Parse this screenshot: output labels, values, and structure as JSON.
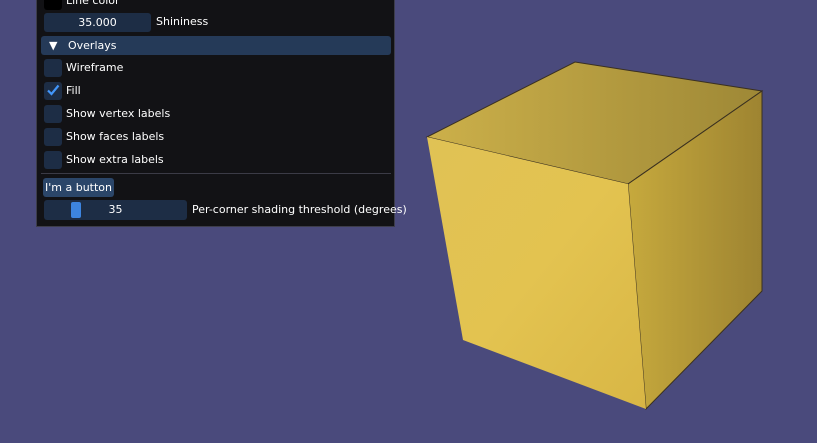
{
  "viewport": {
    "background_color": "#4a4a7c",
    "object": "cube",
    "cube_color": "#e0c14f"
  },
  "panel": {
    "line_color_label": "Line color",
    "line_color_swatch": "#000000",
    "shininess": {
      "value": "35.000",
      "label": "Shininess"
    },
    "overlays_header": {
      "arrow": "▼",
      "label": "Overlays"
    },
    "checkboxes": [
      {
        "label": "Wireframe",
        "checked": false
      },
      {
        "label": "Fill",
        "checked": true
      },
      {
        "label": "Show vertex labels",
        "checked": false
      },
      {
        "label": "Show faces labels",
        "checked": false
      },
      {
        "label": "Show extra labels",
        "checked": false
      }
    ],
    "button_label": "I'm a button",
    "threshold_slider": {
      "value": "35",
      "fraction": 0.194,
      "label": "Per-corner shading threshold (degrees)"
    }
  }
}
